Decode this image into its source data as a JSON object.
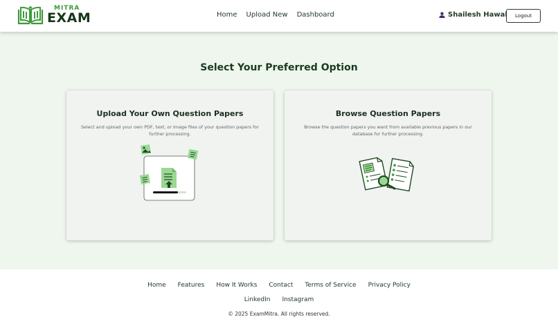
{
  "header": {
    "logo_small": "MITRA",
    "logo_big": "EXAM",
    "nav": [
      {
        "label": "Home"
      },
      {
        "label": "Upload New"
      },
      {
        "label": "Dashboard"
      }
    ],
    "user_name": "Shailesh Hawale",
    "logout_label": "Logout"
  },
  "main": {
    "title": "Select Your Preferred Option",
    "cards": [
      {
        "title": "Upload Your Own Question Papers",
        "description": "Select and upload your own PDF, text, or image files of your question papers for further processing.",
        "icon": "upload-document-icon"
      },
      {
        "title": "Browse Question Papers",
        "description": "Browse the question papers you want from available previous papers in our database for further processing.",
        "icon": "browse-papers-icon"
      }
    ]
  },
  "footer": {
    "links": [
      {
        "label": "Home"
      },
      {
        "label": "Features"
      },
      {
        "label": "How It Works"
      },
      {
        "label": "Contact"
      },
      {
        "label": "Terms of Service"
      },
      {
        "label": "Privacy Policy"
      }
    ],
    "social": [
      {
        "label": "LinkedIn"
      },
      {
        "label": "Instagram"
      }
    ],
    "copyright": "© 2025 ExamMitra. All rights reserved."
  },
  "colors": {
    "brand_green": "#3d9a3a",
    "dark_green": "#17361a",
    "main_bg": "#eef6ee",
    "card_bg": "#f0f3ef",
    "light_green": "#9ad893"
  }
}
